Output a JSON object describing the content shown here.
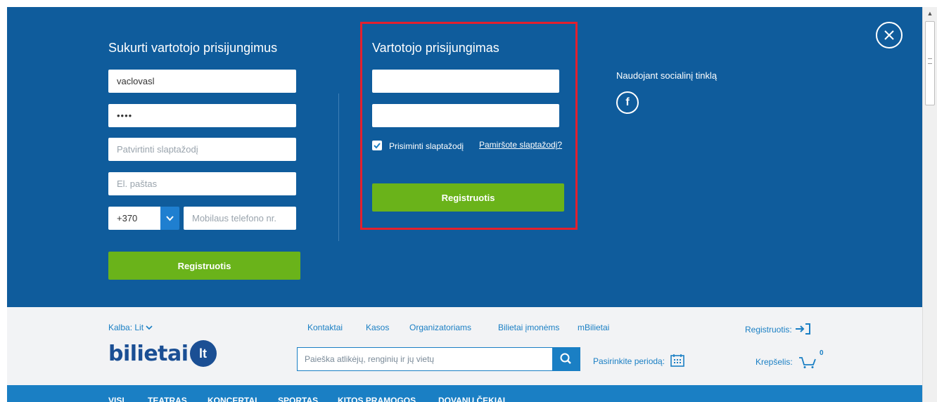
{
  "register": {
    "heading": "Sukurti vartotojo prisijungimus",
    "username_value": "vaclovasl",
    "password_value": "••••",
    "confirm_placeholder": "Patvirtinti slaptažodį",
    "email_placeholder": "El. paštas",
    "country_code": "+370",
    "phone_placeholder": "Mobilaus telefono nr.",
    "button_label": "Registruotis"
  },
  "login": {
    "heading": "Vartotojo prisijungimas",
    "username_value": "",
    "password_value": "",
    "remember_label": "Prisiminti slaptažodį",
    "remember_checked": true,
    "forgot_link": "Pamiršote slaptažodį?",
    "button_label": "Registruotis"
  },
  "social": {
    "label": "Naudojant socialinį tinklą",
    "icon": "facebook-icon"
  },
  "header": {
    "language_label": "Kalba:",
    "language_value": "Lit",
    "top_links": [
      "Kontaktai",
      "Kasos",
      "Organizatoriams",
      "Bilietai įmonėms",
      "mBilietai"
    ],
    "register_link": "Registruotis:",
    "logo_text": "bilietai",
    "logo_badge": "lt",
    "search_placeholder": "Paieška atlikėjų, renginių ir jų vietų",
    "period_label": "Pasirinkite periodą:",
    "cart_label": "Krepšelis:",
    "cart_count": "0"
  },
  "nav": {
    "items": [
      "VISI",
      "TEATRAS",
      "KONCERTAI",
      "SPORTAS",
      "KITOS PRAMOGOS",
      "DOVANŲ ČEKIAI"
    ]
  },
  "colors": {
    "overlay": "#0f5c9c",
    "accent_green": "#6ab31a",
    "accent_blue": "#1a7fc4",
    "highlight_red": "#e3202e"
  }
}
